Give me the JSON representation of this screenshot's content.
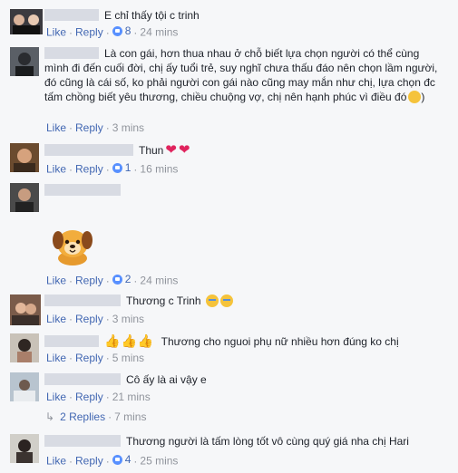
{
  "comments": [
    {
      "text": "E chỉ thấy tội c trinh",
      "like": "Like",
      "reply": "Reply",
      "likes": "8",
      "time": "24 mins"
    },
    {
      "text": "Là con gái, hơn thua nhau ở chỗ biết lựa chọn người có thể cùng mình đi đến cuối đời, chị ấy tuổi trẻ, suy nghĩ chưa thấu đáo nên chọn lầm người, đó cũng là cái số, ko phải người con gái nào cũng may mắn như chị, lựa chọn đc tấm chồng biết yêu thương, chiều chuộng vợ, chị nên hạnh phúc vì điều đó",
      "like": "Like",
      "reply": "Reply",
      "time": "3 mins"
    },
    {
      "text": "Thun",
      "like": "Like",
      "reply": "Reply",
      "likes": "1",
      "time": "16 mins"
    },
    {
      "text": "",
      "like": "Like",
      "reply": "Reply",
      "likes": "2",
      "time": "24 mins"
    },
    {
      "text": "Thương c Trinh",
      "like": "Like",
      "reply": "Reply",
      "time": "3 mins"
    },
    {
      "text": "Thương cho nguoi phụ nữ nhiều hơn đúng ko chị",
      "like": "Like",
      "reply": "Reply",
      "time": "5 mins"
    },
    {
      "text": "Cô ấy là ai vậy e",
      "like": "Like",
      "reply": "Reply",
      "time": "21 mins"
    },
    {
      "text": "Thương người là tấm lòng tốt vô cùng quý giá nha chị Hari",
      "like": "Like",
      "reply": "Reply",
      "likes": "4",
      "time": "25 mins"
    }
  ],
  "replies": {
    "label": "2 Replies",
    "time": "7 mins"
  },
  "colors": {
    "link": "#4267b2",
    "meta": "#90949c",
    "text": "#1d2129",
    "background": "#f6f7f9"
  }
}
